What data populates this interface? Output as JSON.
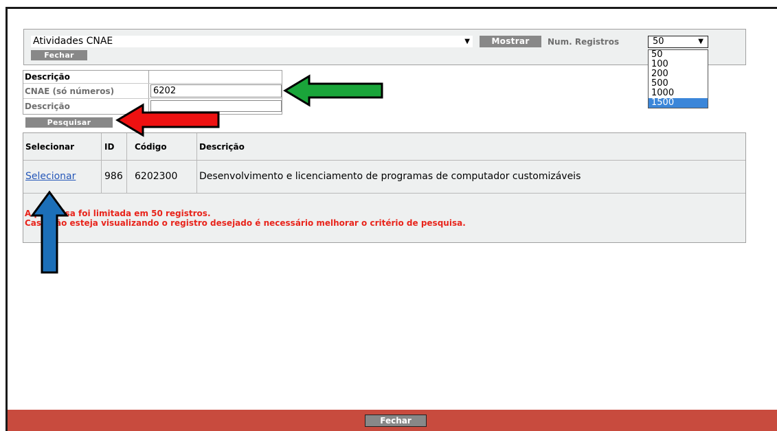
{
  "toolbar": {
    "select_value": "Atividades CNAE",
    "mostrar_label": "Mostrar",
    "num_registros_label": "Num. Registros",
    "num_registros_value": "50",
    "fechar_label": "Fechar"
  },
  "num_options": [
    "50",
    "100",
    "200",
    "500",
    "1000",
    "1500"
  ],
  "num_options_highlighted": "1500",
  "form": {
    "header": "Descrição",
    "cnae_label": "CNAE (só números)",
    "cnae_value": "6202",
    "descricao_label": "Descrição",
    "descricao_value": "",
    "pesquisar_label": "Pesquisar"
  },
  "results": {
    "columns": [
      "Selecionar",
      "ID",
      "Código",
      "Descrição"
    ],
    "rows": [
      {
        "action": "Selecionar",
        "id": "986",
        "codigo": "6202300",
        "descricao": "Desenvolvimento e licenciamento de programas de computador customizáveis"
      }
    ],
    "warning_line1": "A pesquisa foi limitada em 50 registros.",
    "warning_line2": "Caso não esteja visualizando o registro desejado é necessário melhorar o critério de pesquisa."
  },
  "footer": {
    "fechar_label": "Fechar"
  },
  "colors": {
    "green_arrow": "#1aa53a",
    "red_arrow": "#ee1111",
    "blue_arrow": "#1c6fb8",
    "footer_bar": "#c84b3e",
    "warning_text": "#e8241b"
  }
}
